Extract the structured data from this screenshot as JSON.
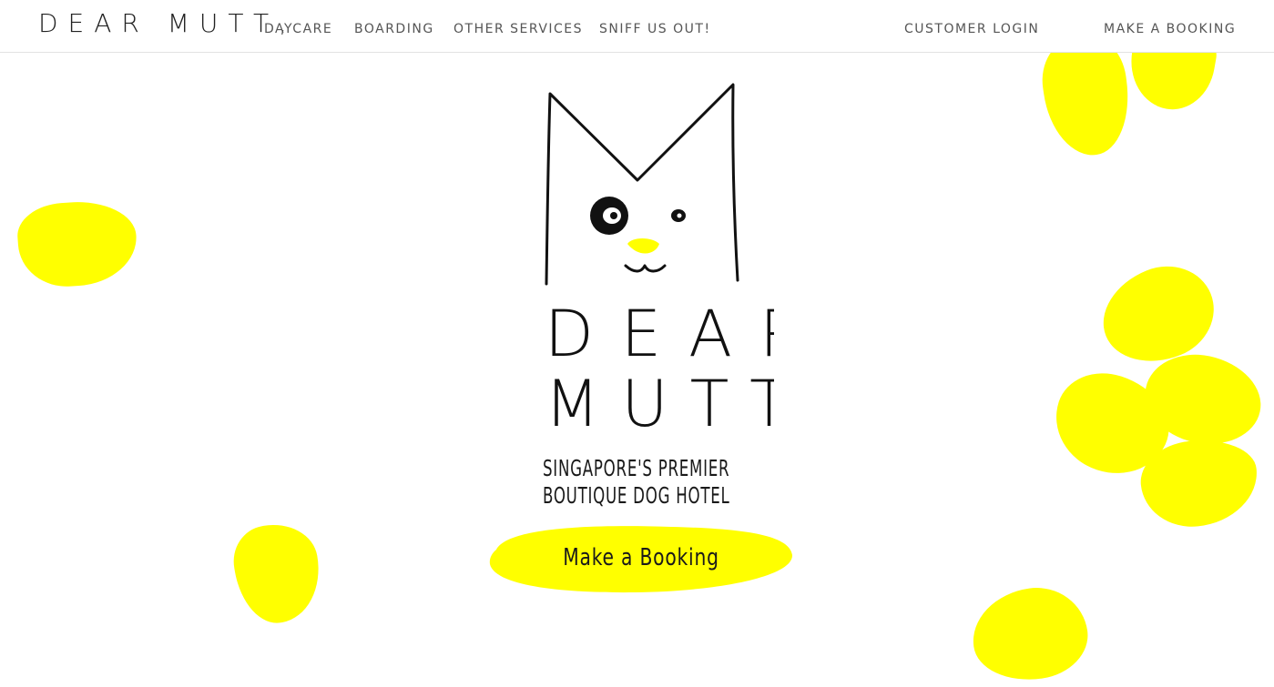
{
  "header": {
    "brand": "DEAR MUTT,",
    "nav": [
      "DAYCARE",
      "BOARDING",
      "OTHER SERVICES",
      "SNIFF US OUT!"
    ],
    "customer_login": "CUSTOMER LOGIN",
    "make_booking": "MAKE A BOOKING"
  },
  "hero": {
    "logo_line1": "DEAR",
    "logo_line2": "MUTT,",
    "tagline_line1": "SINGAPORE'S PREMIER",
    "tagline_line2": "BOUTIQUE DOG HOTEL",
    "cta_label": "Make a Booking"
  },
  "colors": {
    "accent": "#ffff00",
    "text": "#1a1a1a",
    "nav": "#555555"
  }
}
